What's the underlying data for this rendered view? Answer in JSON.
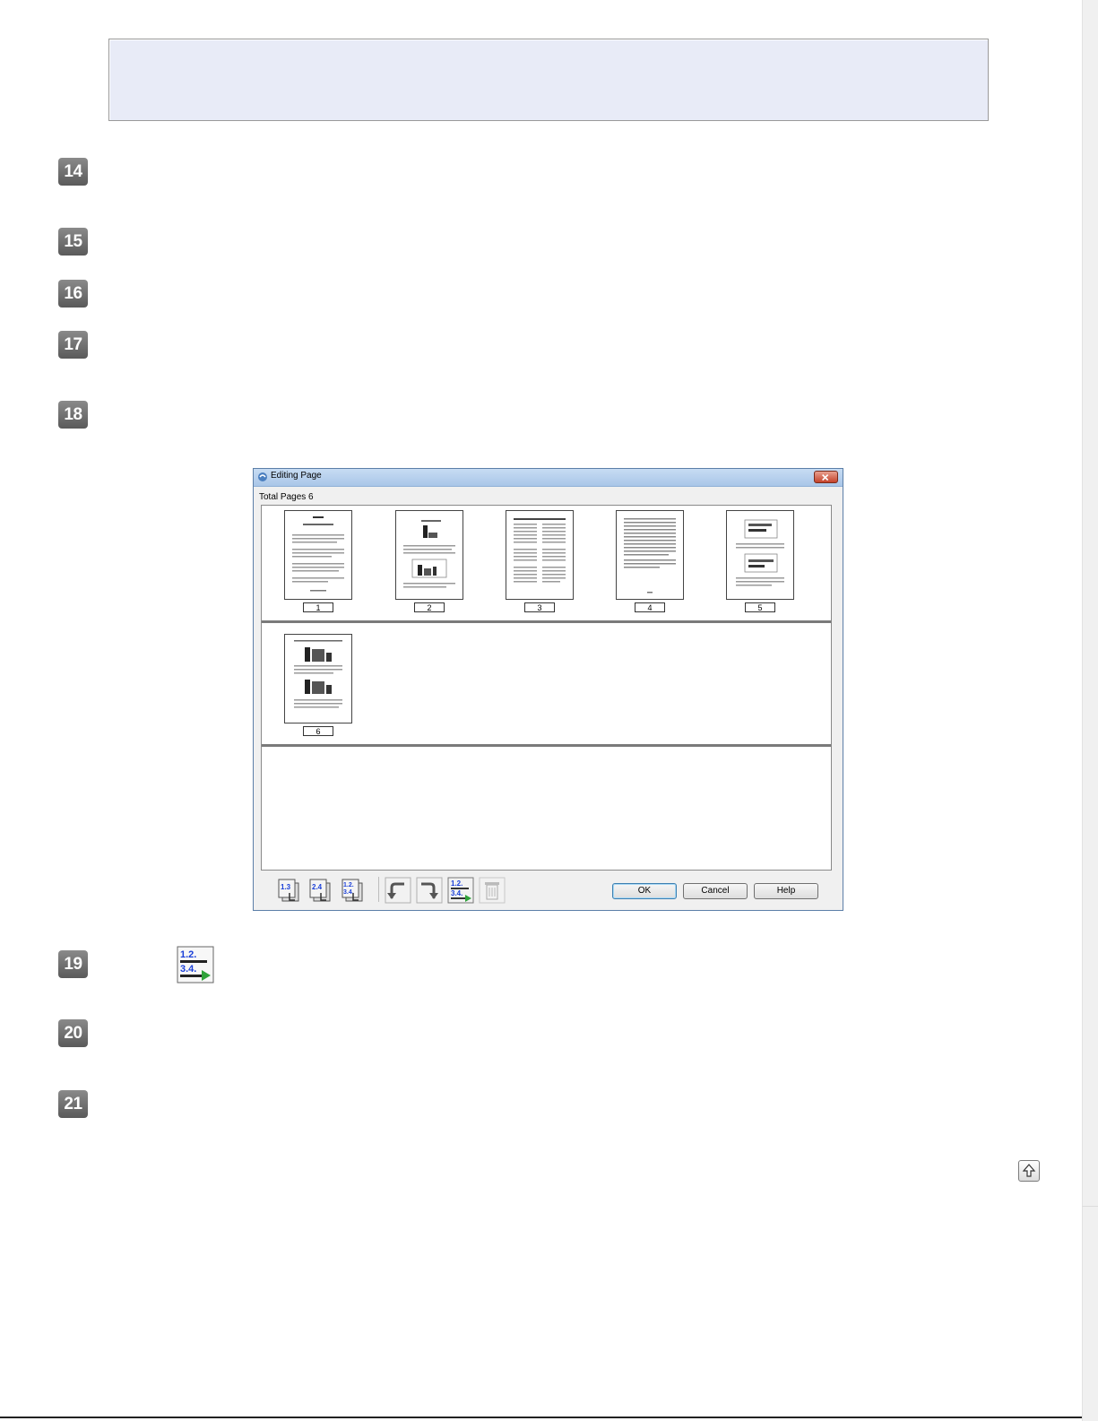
{
  "steps": [
    "14",
    "15",
    "16",
    "17",
    "18",
    "19",
    "20",
    "21"
  ],
  "dialog": {
    "title": "Editing Page",
    "total_pages_label": "Total Pages 6",
    "pages": [
      "1",
      "2",
      "3",
      "4",
      "5",
      "6"
    ],
    "toolbar": {
      "icons": [
        "select-odd-pages-icon",
        "select-even-pages-icon",
        "select-all-pages-icon",
        "rotate-left-icon",
        "rotate-right-icon",
        "reorder-pages-icon",
        "delete-icon"
      ]
    },
    "buttons": {
      "ok": "OK",
      "cancel": "Cancel",
      "help": "Help"
    }
  },
  "inline_icon": "reorder-pages-icon",
  "top_link_icon": "arrow-up-icon"
}
